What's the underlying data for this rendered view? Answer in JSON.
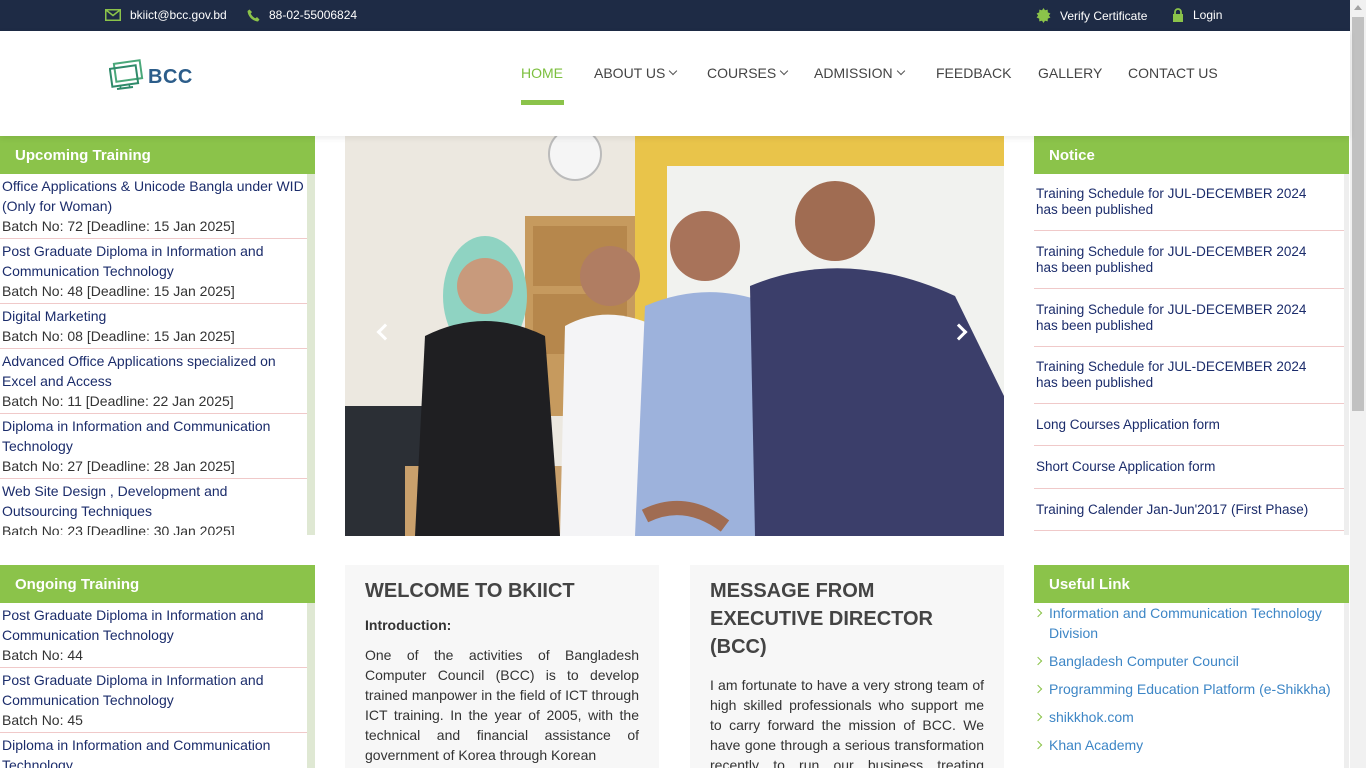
{
  "topbar": {
    "email": "bkiict@bcc.gov.bd",
    "phone": "88-02-55006824",
    "verify": "Verify Certificate",
    "login": "Login"
  },
  "brand": {
    "logo_text": "BCC",
    "accent_color": "#8bc34a",
    "topbar_color": "#1e2b45"
  },
  "nav": {
    "home": "HOME",
    "about": "ABOUT US",
    "courses": "COURSES",
    "admission": "ADMISSION",
    "feedback": "FEEDBACK",
    "gallery": "GALLERY",
    "contact": "CONTACT US"
  },
  "upcoming": {
    "title": "Upcoming Training",
    "items": [
      {
        "title": "Office Applications & Unicode Bangla under WID (Only for Woman)",
        "meta": "Batch No: 72  [Deadline: 15 Jan 2025]"
      },
      {
        "title": "Post Graduate Diploma in Information and Communication Technology",
        "meta": "Batch No: 48  [Deadline: 15 Jan 2025]"
      },
      {
        "title": "Digital Marketing",
        "meta": "Batch No: 08  [Deadline: 15 Jan 2025]"
      },
      {
        "title": "Advanced Office Applications specialized on Excel and Access",
        "meta": "Batch No: 11  [Deadline: 22 Jan 2025]"
      },
      {
        "title": "Diploma in Information and Communication Technology",
        "meta": "Batch No: 27  [Deadline: 28 Jan 2025]"
      },
      {
        "title": "Web Site Design , Development and Outsourcing Techniques",
        "meta": "Batch No: 23  [Deadline: 30 Jan 2025]"
      }
    ]
  },
  "notice": {
    "title": "Notice",
    "items": [
      "Training Schedule for JUL-DECEMBER 2024 has been published",
      "Training Schedule for JUL-DECEMBER 2024 has been published",
      "Training Schedule for JUL-DECEMBER 2024 has been published",
      "Training Schedule for JUL-DECEMBER 2024 has been published",
      "Long Courses Application form",
      "Short Course Application form",
      "Training Calender Jan-Jun'2017 (First Phase)"
    ]
  },
  "ongoing": {
    "title": "Ongoing Training",
    "items": [
      {
        "title": "Post Graduate Diploma in Information and Communication Technology",
        "meta": "Batch No: 44"
      },
      {
        "title": "Post Graduate Diploma in Information and Communication Technology",
        "meta": "Batch No: 45"
      },
      {
        "title": "Diploma in Information and Communication Technology",
        "meta": ""
      }
    ]
  },
  "welcome": {
    "title": "WELCOME TO BKIICT",
    "subtitle": "Introduction:",
    "text": "One of the activities of Bangladesh Computer Council (BCC) is to develop trained manpower in the field of ICT through ICT training. In the year of 2005, with the technical and financial assistance of government of Korea through Korean"
  },
  "message": {
    "title": "MESSAGE FROM EXECUTIVE DIRECTOR (BCC)",
    "text": "I am fortunate  to have a very strong team of high skilled professionals who support me to carry forward the mission of  BCC. We have gone through a serious transformation recently to run our business treating everyone coming to us a customer. This"
  },
  "useful": {
    "title": "Useful Link",
    "items": [
      "Information and Communication Technology Division",
      "Bangladesh Computer Council",
      "Programming Education Platform (e-Shikkha)",
      "shikkhok.com",
      "Khan Academy"
    ]
  }
}
